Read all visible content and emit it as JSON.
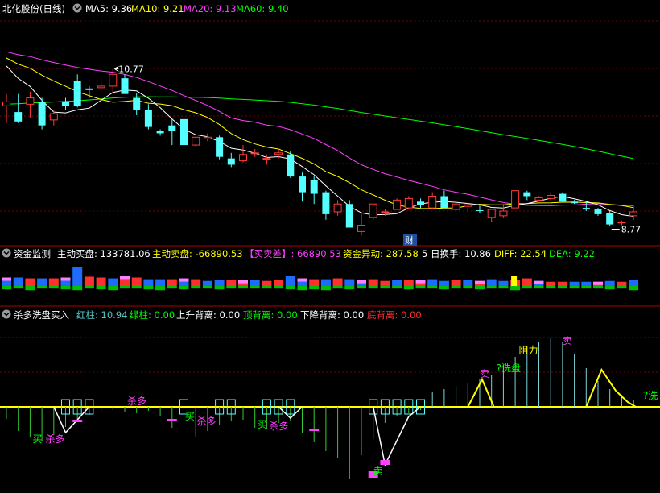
{
  "colors": {
    "bg": "#000000",
    "up": "#ff3b3b",
    "down": "#54ffff",
    "ma5": "#ffffff",
    "ma10": "#ffff00",
    "ma20": "#ff40ff",
    "ma60": "#00ff00",
    "grid": "#7a0000",
    "sep": "#b00000",
    "buy_vol": "#ff3030",
    "sell_vol": "#00c000",
    "label_yellow": "#ffff00",
    "label_magenta": "#ff40ff",
    "label_green": "#00ff00",
    "label_red": "#ff3030",
    "blue": "#1e6cff",
    "pink": "#ff80ff"
  },
  "panel1": {
    "icon": "circle-chevron-down-icon",
    "title": "北化股份(日线)",
    "ma5_label": "MA5: 9.36",
    "ma10_label": "MA10: 9.21",
    "ma20_label": "MA20: 9.13",
    "ma60_label": "MA60: 9.40",
    "high_marker": "10.77",
    "low_marker": "8.77",
    "badge": "财"
  },
  "panel2": {
    "icon": "circle-chevron-down-icon",
    "name": "资金监测",
    "buy_label": "主动买盘: 133781.06",
    "sell_label": "主动卖盘: -66890.53",
    "diff_label": "【买卖差】: 66890.53",
    "abn_label": "资金异动: 287.58",
    "turnover_label": "5 日换手: 10.86",
    "diff_val": "DIFF: 22.54",
    "dea_val": "DEA: 9.22"
  },
  "panel3": {
    "icon": "circle-chevron-down-icon",
    "name": "杀多洗盘买入",
    "red_label": "红柱: 10.94",
    "green_label": "绿柱: 0.00",
    "up_div_label": "上升背离: 0.00",
    "top_div_label": "顶背离: 0.00",
    "down_div_label": "下降背离: 0.00",
    "bottom_div_label": "底背离: 0.00",
    "annotations": [
      {
        "text": "买",
        "bar": 2.2,
        "v": -4.4,
        "color": "label_green"
      },
      {
        "text": "杀多",
        "bar": 3.3,
        "v": -4.4,
        "color": "label_magenta"
      },
      {
        "text": "杀多",
        "bar": 10.2,
        "v": 0.3,
        "color": "label_magenta"
      },
      {
        "text": "买",
        "bar": 15.1,
        "v": -1.6,
        "color": "label_green"
      },
      {
        "text": "杀多",
        "bar": 16.1,
        "v": -2.2,
        "color": "label_magenta"
      },
      {
        "text": "买",
        "bar": 21.2,
        "v": -2.6,
        "color": "label_green"
      },
      {
        "text": "杀多",
        "bar": 22.2,
        "v": -2.8,
        "color": "label_magenta"
      },
      {
        "text": "卖",
        "bar": 31.0,
        "v": -8.4,
        "color": "label_green"
      },
      {
        "text": "卖",
        "bar": 40.0,
        "v": 3.7,
        "color": "label_magenta"
      },
      {
        "text": "?洗盘",
        "bar": 41.4,
        "v": 4.4,
        "color": "label_green"
      },
      {
        "text": "阻力",
        "bar": 43.3,
        "v": 6.6,
        "color": "label_yellow"
      },
      {
        "text": "卖",
        "bar": 47.0,
        "v": 7.8,
        "color": "label_magenta"
      },
      {
        "text": "?洗",
        "bar": 53.8,
        "v": 1.0,
        "color": "label_green"
      }
    ]
  },
  "chart_data": [
    {
      "type": "candlestick",
      "title": "北化股份(日线)",
      "ylim": [
        8.55,
        11.4
      ],
      "series": [
        {
          "name": "K",
          "ohlc": [
            [
              10.3,
              10.45,
              10.08,
              10.35
            ],
            [
              10.22,
              10.45,
              10.08,
              10.1
            ],
            [
              10.32,
              10.48,
              10.15,
              10.4
            ],
            [
              10.35,
              10.4,
              10.0,
              10.05
            ],
            [
              10.12,
              10.25,
              10.05,
              10.2
            ],
            [
              10.35,
              10.4,
              10.25,
              10.3
            ],
            [
              10.62,
              10.7,
              10.28,
              10.3
            ],
            [
              10.52,
              10.55,
              10.4,
              10.5
            ],
            [
              10.53,
              10.66,
              10.5,
              10.55
            ],
            [
              10.55,
              10.77,
              10.45,
              10.7
            ],
            [
              10.65,
              10.7,
              10.45,
              10.45
            ],
            [
              10.4,
              10.46,
              10.18,
              10.25
            ],
            [
              10.25,
              10.32,
              10.0,
              10.03
            ],
            [
              9.98,
              10.0,
              9.92,
              9.95
            ],
            [
              10.05,
              10.13,
              9.8,
              9.98
            ],
            [
              10.13,
              10.2,
              9.8,
              9.8
            ],
            [
              9.8,
              9.9,
              9.78,
              9.9
            ],
            [
              9.88,
              9.95,
              9.85,
              9.9
            ],
            [
              9.9,
              9.92,
              9.62,
              9.65
            ],
            [
              9.63,
              9.7,
              9.52,
              9.55
            ],
            [
              9.6,
              9.8,
              9.58,
              9.68
            ],
            [
              9.7,
              9.75,
              9.65,
              9.7
            ],
            [
              9.62,
              9.68,
              9.55,
              9.63
            ],
            [
              9.68,
              9.75,
              9.63,
              9.7
            ],
            [
              9.68,
              9.72,
              9.38,
              9.4
            ],
            [
              9.4,
              9.45,
              9.08,
              9.2
            ],
            [
              9.35,
              9.4,
              9.05,
              9.18
            ],
            [
              9.2,
              9.22,
              8.85,
              8.92
            ],
            [
              8.95,
              9.1,
              8.9,
              9.05
            ],
            [
              9.05,
              9.1,
              8.78,
              8.75
            ],
            [
              8.7,
              8.95,
              8.65,
              8.78
            ],
            [
              8.88,
              9.05,
              8.85,
              9.05
            ],
            [
              8.95,
              8.98,
              8.9,
              8.95
            ],
            [
              8.98,
              9.12,
              8.98,
              9.1
            ],
            [
              9.0,
              9.15,
              8.98,
              9.12
            ],
            [
              9.08,
              9.12,
              9.0,
              9.04
            ],
            [
              9.0,
              9.2,
              8.98,
              9.15
            ],
            [
              9.15,
              9.22,
              9.0,
              9.0
            ],
            [
              8.98,
              9.1,
              8.96,
              9.05
            ],
            [
              9.02,
              9.07,
              8.95,
              9.04
            ],
            [
              8.97,
              9.03,
              8.94,
              8.96
            ],
            [
              8.88,
              8.99,
              8.82,
              8.98
            ],
            [
              8.9,
              9.05,
              8.88,
              8.96
            ],
            [
              9.0,
              9.2,
              9.0,
              9.22
            ],
            [
              9.2,
              9.22,
              9.1,
              9.15
            ],
            [
              9.1,
              9.15,
              9.08,
              9.13
            ],
            [
              9.12,
              9.2,
              9.09,
              9.16
            ],
            [
              9.18,
              9.2,
              9.08,
              9.08
            ],
            [
              9.08,
              9.1,
              9.05,
              9.06
            ],
            [
              9.0,
              9.08,
              8.96,
              8.98
            ],
            [
              8.98,
              9.0,
              8.9,
              8.92
            ],
            [
              8.93,
              8.96,
              8.77,
              8.79
            ],
            [
              8.81,
              8.84,
              8.78,
              8.82
            ],
            [
              8.9,
              9.03,
              8.85,
              8.95
            ]
          ]
        }
      ]
    },
    {
      "type": "bar",
      "title": "资金监测",
      "ylim": [
        -10,
        14
      ],
      "series": [
        {
          "name": "主动买盘",
          "values": [
            10,
            10,
            9,
            9,
            9,
            10,
            22,
            11,
            10,
            9,
            12,
            10,
            8,
            8,
            8,
            9,
            8,
            6,
            7,
            7,
            7,
            7,
            6,
            7,
            12,
            9,
            8,
            8,
            9,
            8,
            7,
            8,
            6,
            7,
            7,
            7,
            8,
            6,
            7,
            7,
            6,
            8,
            6,
            7,
            9,
            6,
            5,
            5,
            5,
            5,
            5,
            6,
            5,
            7
          ]
        },
        {
          "name": "主动卖盘",
          "values": [
            -4,
            -3,
            -5,
            -3,
            -3,
            -4,
            -5,
            -3,
            -4,
            -5,
            -3,
            -3,
            -4,
            -5,
            -3,
            -4,
            -3,
            -3,
            -4,
            -3,
            -3,
            -3,
            -3,
            -3,
            -4,
            -5,
            -4,
            -5,
            -3,
            -4,
            -3,
            -3,
            -3,
            -3,
            -4,
            -3,
            -3,
            -4,
            -3,
            -3,
            -4,
            -3,
            -3,
            -5,
            -3,
            -3,
            -3,
            -3,
            -3,
            -3,
            -3,
            -4,
            -3,
            -5
          ]
        }
      ]
    },
    {
      "type": "bar",
      "title": "杀多洗盘买入",
      "ylim": [
        -10,
        10
      ],
      "series": [
        {
          "name": "红柱",
          "values": [
            0,
            0,
            0,
            0,
            0,
            0,
            0,
            0,
            0,
            0,
            0,
            0,
            0,
            0,
            0,
            0,
            0,
            0,
            0,
            0,
            0,
            0,
            0,
            0,
            0,
            0,
            0,
            0,
            0,
            0,
            0,
            0,
            0,
            0,
            0,
            0,
            1.8,
            2.2,
            2.6,
            3.0,
            3.4,
            4.0,
            5.2,
            6.2,
            7.5,
            8.0,
            8.6,
            8.0,
            6.5,
            4.8,
            3.2,
            2.2,
            1.5,
            0.8
          ]
        },
        {
          "name": "绿柱",
          "values": [
            -1.5,
            -3.0,
            -3.8,
            -4.2,
            -3.5,
            -2.5,
            -1.5,
            -1.0,
            -0.6,
            -0.4,
            -0.6,
            -0.8,
            -0.5,
            -1.2,
            -2.6,
            -3.1,
            -3.8,
            -3.0,
            -2.2,
            -1.8,
            -1.6,
            -2.6,
            -2.8,
            -2.0,
            -1.8,
            -3.3,
            -4.4,
            -5.5,
            -6.4,
            -9.0,
            -6.0,
            -4.0,
            -2.0,
            -1.2,
            -0.8,
            -0.4,
            0,
            0,
            0,
            0,
            0,
            0,
            0,
            0,
            0,
            0,
            0,
            0,
            0,
            0,
            0,
            0,
            0,
            0
          ]
        }
      ]
    }
  ]
}
